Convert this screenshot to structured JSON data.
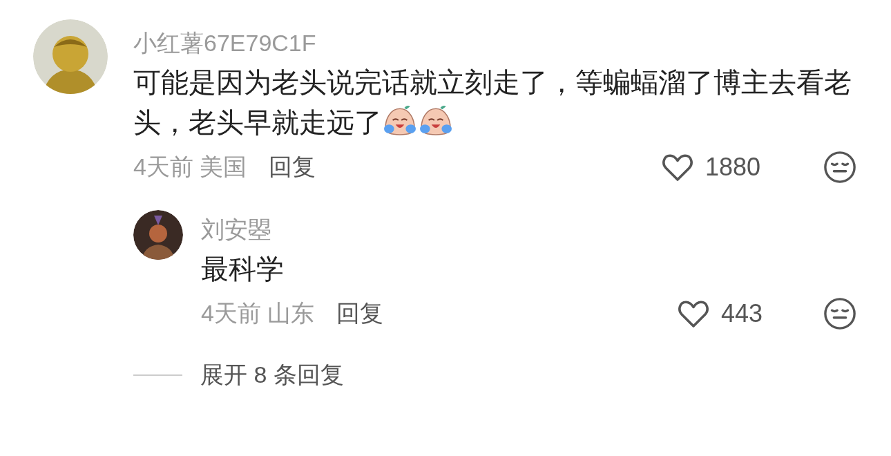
{
  "comments": [
    {
      "username": "小红薯67E79C1F",
      "content": "可能是因为老头说完话就立刻走了，等蝙蝠溜了博主去看老头，老头早就走远了",
      "emojis": [
        {
          "kind": "laugh-cry"
        },
        {
          "kind": "laugh-cry"
        }
      ],
      "time": "4天前",
      "location": "美国",
      "reply_label": "回复",
      "likes": "1880",
      "replies": [
        {
          "username": "刘安曌",
          "content": "最科学",
          "time": "4天前",
          "location": "山东",
          "reply_label": "回复",
          "likes": "443"
        }
      ],
      "expand_label": "展开 8 条回复"
    }
  ]
}
